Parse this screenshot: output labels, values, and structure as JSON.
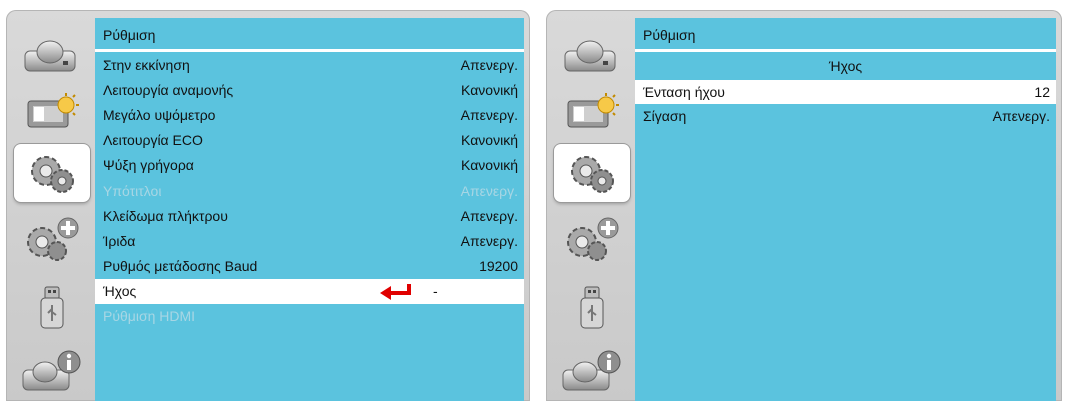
{
  "left": {
    "title": "Ρύθμιση",
    "rows": [
      {
        "label": "Στην εκκίνηση",
        "value": "Απενεργ."
      },
      {
        "label": "Λειτουργία αναμονής",
        "value": "Κανονική"
      },
      {
        "label": "Μεγάλο υψόμετρο",
        "value": "Απενεργ."
      },
      {
        "label": "Λειτουργία ECO",
        "value": "Κανονική"
      },
      {
        "label": "Ψύξη γρήγορα",
        "value": "Κανονική"
      },
      {
        "label": "Υπότιτλοι",
        "value": "Απενεργ."
      },
      {
        "label": "Κλείδωμα πλήκτρου",
        "value": "Απενεργ."
      },
      {
        "label": "Ίριδα",
        "value": "Απενεργ."
      },
      {
        "label": "Ρυθμός μετάδοσης Baud",
        "value": "19200"
      },
      {
        "label": "Ήχος",
        "value": "-"
      },
      {
        "label": "Ρύθμιση HDMI",
        "value": ""
      }
    ]
  },
  "right": {
    "title": "Ρύθμιση",
    "subtitle": "Ήχος",
    "rows": [
      {
        "label": "Ένταση ήχου",
        "value": "12"
      },
      {
        "label": "Σίγαση",
        "value": "Απενεργ."
      }
    ]
  },
  "colors": {
    "menu_bg": "#5bc3de",
    "highlight": "#ffffff",
    "arrow": "#e00000",
    "disabled_text": "#a7d6e4"
  },
  "icons": [
    "camera-icon",
    "display-settings-icon",
    "gears-icon",
    "gears-plus-icon",
    "usb-icon",
    "info-icon"
  ]
}
